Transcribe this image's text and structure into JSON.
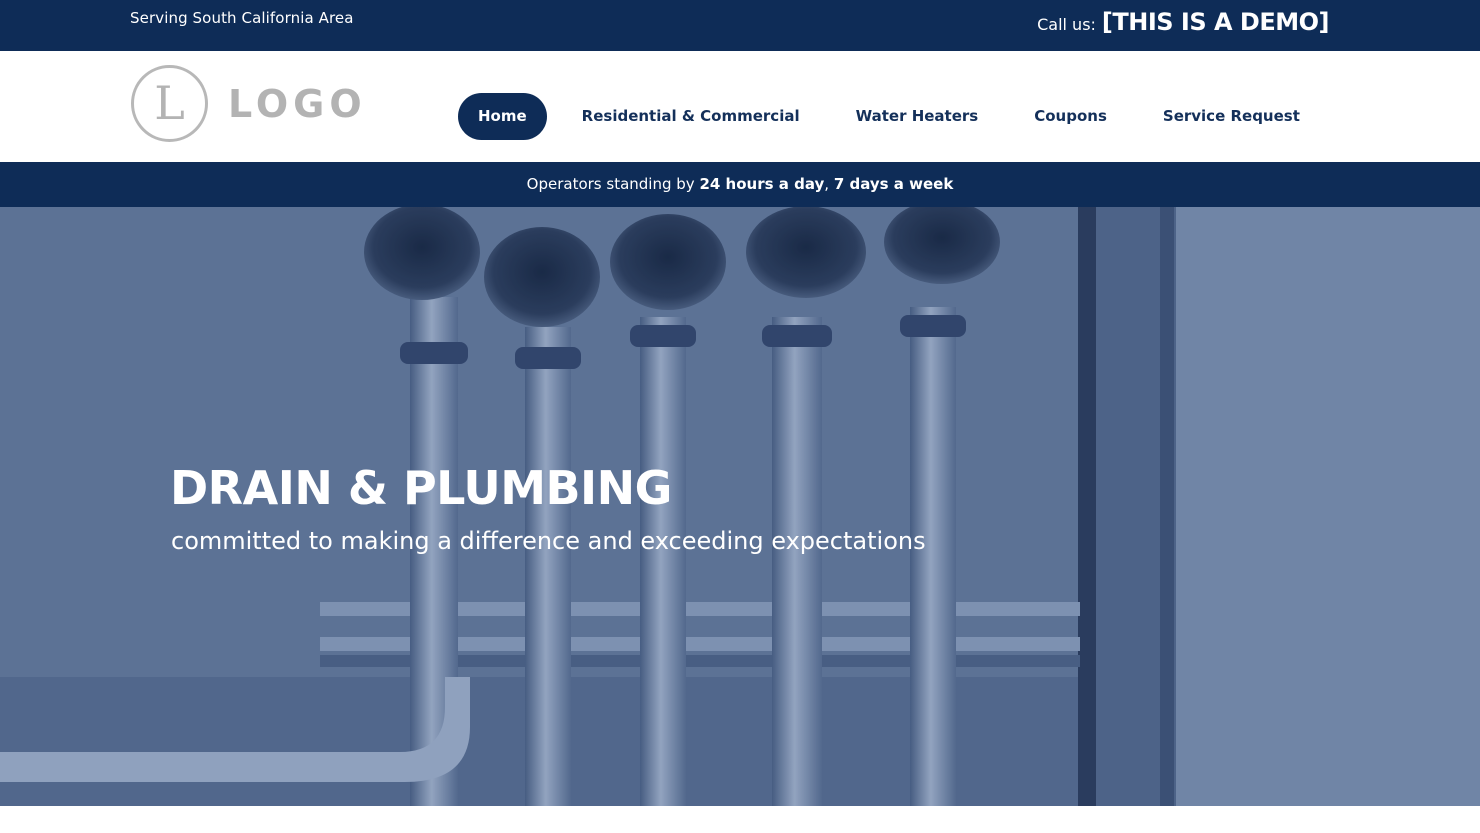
{
  "topbar": {
    "serving": "Serving South California Area",
    "call_label": "Call us:",
    "call_number": "[THIS IS A DEMO]"
  },
  "header": {
    "logo_letter": "L",
    "logo_text": "LOGO",
    "nav": [
      {
        "label": "Home",
        "active": true
      },
      {
        "label": "Residential & Commercial",
        "active": false
      },
      {
        "label": "Water Heaters",
        "active": false
      },
      {
        "label": "Coupons",
        "active": false
      },
      {
        "label": "Service Request",
        "active": false
      }
    ]
  },
  "announcement": {
    "prefix": "Operators standing by ",
    "hours": "24 hours a day",
    "separator": ", ",
    "days": "7 days a week"
  },
  "hero": {
    "title": "DRAIN & PLUMBING",
    "subtitle": "committed to making a difference and exceeding expectations",
    "overlay_color": "#5d7293"
  },
  "colors": {
    "brand_navy": "#0e2c57",
    "nav_text": "#14305a",
    "logo_gray": "#b3b3b3"
  }
}
